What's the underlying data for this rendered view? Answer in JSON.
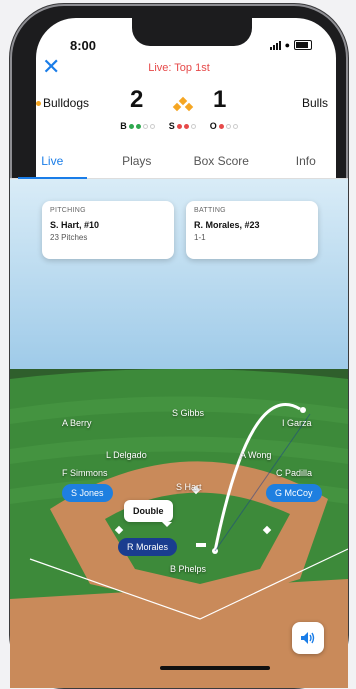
{
  "status_bar": {
    "time": "8:00"
  },
  "header": {
    "live_status": "Live: Top 1st",
    "close_icon": "close-x-icon"
  },
  "scoreboard": {
    "home_team": "Bulldogs",
    "away_team": "Bulls",
    "home_score": "2",
    "away_score": "1",
    "balls_label": "B",
    "strikes_label": "S",
    "outs_label": "O",
    "balls": 2,
    "strikes": 2,
    "outs": 1
  },
  "tabs": [
    {
      "label": "Live",
      "active": true
    },
    {
      "label": "Plays"
    },
    {
      "label": "Box Score"
    },
    {
      "label": "Info"
    }
  ],
  "pitching": {
    "title": "PITCHING",
    "name": "S. Hart, #10",
    "detail": "23 Pitches"
  },
  "batting": {
    "title": "BATTING",
    "name": "R. Morales, #23",
    "detail": "1-1"
  },
  "fielders": {
    "left_field": "A Berry",
    "center_field": "S Gibbs",
    "right_field": "I Garza",
    "shortstop": "L Delgado",
    "second_base": "A Wong",
    "third_base": "F Simmons",
    "first_base": "C Padilla",
    "pitcher": "S Hart",
    "catcher": "B Phelps"
  },
  "runners": {
    "third": "S Jones",
    "first": "G McCoy"
  },
  "batter": {
    "name": "R Morales"
  },
  "play_tooltip": "Double",
  "colors": {
    "accent": "#1a7de8",
    "live": "#e64a4a",
    "grass": "#3d8a3a",
    "dirt": "#c98a5a"
  }
}
